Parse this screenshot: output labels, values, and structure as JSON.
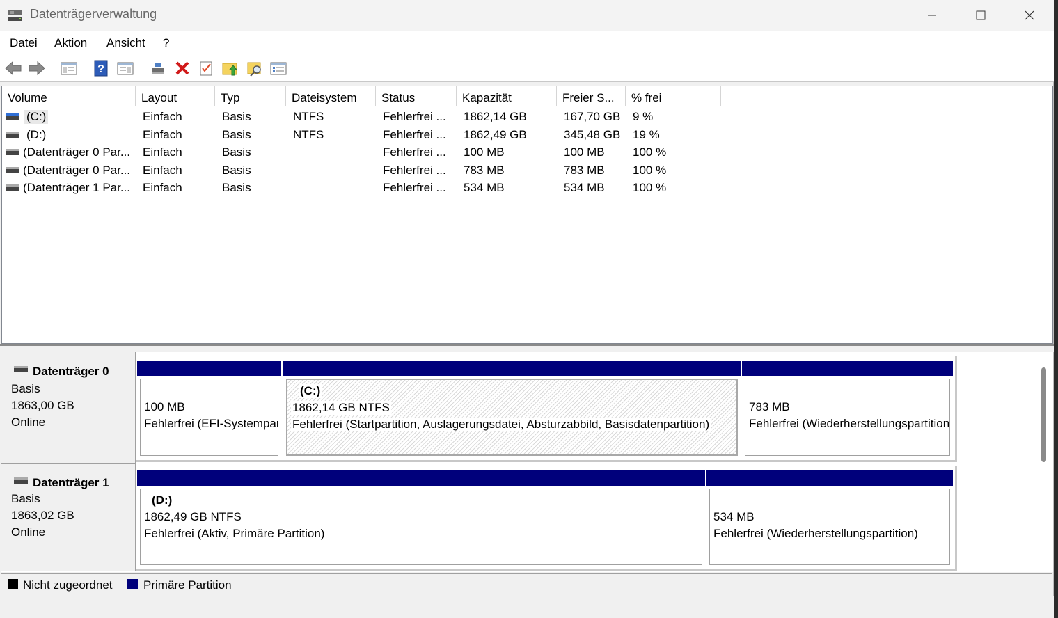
{
  "window": {
    "title": "Datenträgerverwaltung"
  },
  "menu": {
    "items": [
      "Datei",
      "Aktion",
      "Ansicht",
      "?"
    ]
  },
  "toolbar": {
    "icons": [
      "back-arrow-icon",
      "forward-arrow-icon",
      "show-hide-tree-icon",
      "help-icon",
      "properties-icon",
      "connect-disk-icon",
      "delete-icon",
      "checklist-icon",
      "folder-up-icon",
      "folder-search-icon",
      "list-view-icon"
    ]
  },
  "volume_list": {
    "columns": [
      "Volume",
      "Layout",
      "Typ",
      "Dateisystem",
      "Status",
      "Kapazität",
      "Freier S...",
      "% frei"
    ],
    "rows": [
      {
        "volume": "(C:)",
        "layout": "Einfach",
        "typ": "Basis",
        "fs": "NTFS",
        "status": "Fehlerfrei ...",
        "capacity": "1862,14 GB",
        "free": "167,70 GB",
        "pct": "9 %",
        "icon": "system-drive-icon"
      },
      {
        "volume": "(D:)",
        "layout": "Einfach",
        "typ": "Basis",
        "fs": "NTFS",
        "status": "Fehlerfrei ...",
        "capacity": "1862,49 GB",
        "free": "345,48 GB",
        "pct": "19 %",
        "icon": "drive-icon"
      },
      {
        "volume": "(Datenträger 0 Par...",
        "layout": "Einfach",
        "typ": "Basis",
        "fs": "",
        "status": "Fehlerfrei ...",
        "capacity": "100 MB",
        "free": "100 MB",
        "pct": "100 %",
        "icon": "drive-icon"
      },
      {
        "volume": "(Datenträger 0 Par...",
        "layout": "Einfach",
        "typ": "Basis",
        "fs": "",
        "status": "Fehlerfrei ...",
        "capacity": "783 MB",
        "free": "783 MB",
        "pct": "100 %",
        "icon": "drive-icon"
      },
      {
        "volume": "(Datenträger 1 Par...",
        "layout": "Einfach",
        "typ": "Basis",
        "fs": "",
        "status": "Fehlerfrei ...",
        "capacity": "534 MB",
        "free": "534 MB",
        "pct": "100 %",
        "icon": "drive-icon"
      }
    ]
  },
  "disks": [
    {
      "name": "Datenträger 0",
      "type": "Basis",
      "size": "1863,00 GB",
      "state": "Online",
      "partitions": [
        {
          "name": "",
          "line1": "100 MB",
          "line2": "Fehlerfrei (EFI-Systempartition)",
          "hatched": false
        },
        {
          "name": "(C:)",
          "line1": "1862,14 GB NTFS",
          "line2": "Fehlerfrei (Startpartition, Auslagerungsdatei, Absturzabbild, Basisdatenpartition)",
          "hatched": true
        },
        {
          "name": "",
          "line1": "783 MB",
          "line2": "Fehlerfrei (Wiederherstellungspartition)",
          "hatched": false
        }
      ]
    },
    {
      "name": "Datenträger 1",
      "type": "Basis",
      "size": "1863,02 GB",
      "state": "Online",
      "partitions": [
        {
          "name": "(D:)",
          "line1": "1862,49 GB NTFS",
          "line2": "Fehlerfrei (Aktiv, Primäre Partition)",
          "hatched": false
        },
        {
          "name": "",
          "line1": "534 MB",
          "line2": "Fehlerfrei (Wiederherstellungspartition)",
          "hatched": false
        }
      ]
    }
  ],
  "legend": [
    {
      "label": "Nicht zugeordnet",
      "color": "#000000"
    },
    {
      "label": "Primäre Partition",
      "color": "#00007b"
    }
  ],
  "colors": {
    "primary_partition": "#00007b",
    "unallocated": "#000000"
  }
}
